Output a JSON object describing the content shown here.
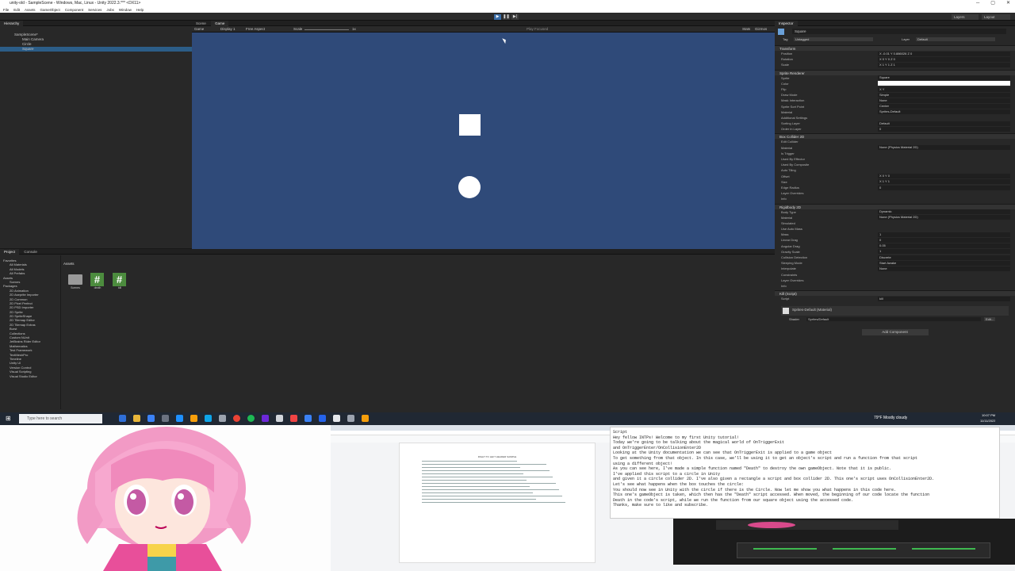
{
  "window": {
    "title": "unity-old - SampleScene - Windows, Mac, Linux - Unity 2022.3.*** <DX11>",
    "menu": [
      "File",
      "Edit",
      "Assets",
      "GameObject",
      "Component",
      "Services",
      "Jobs",
      "Window",
      "Help"
    ],
    "controls": [
      "─",
      "▢",
      "✕"
    ]
  },
  "toolbar": {
    "play": "▶",
    "pause": "❚❚",
    "step": "▶|",
    "layers": "Layers",
    "layout": "Layout"
  },
  "hierarchy": {
    "tab": "Hierarchy",
    "items": [
      "SampleScene*",
      "Main Camera",
      "Circle",
      "Square"
    ]
  },
  "scene": {
    "tabs": [
      "Scene",
      "Game"
    ],
    "toolbar": [
      "Game",
      "Display 1",
      "Free Aspect",
      "Scale",
      "1x",
      "Play Focused",
      "Stats",
      "Gizmos"
    ]
  },
  "project": {
    "tabs": [
      "Project",
      "Console"
    ],
    "tree": [
      "Favorites",
      "All Materials",
      "All Models",
      "All Prefabs",
      "Assets",
      "Scenes",
      "Packages",
      "2D Animation",
      "2D Aseprite Importer",
      "2D Common",
      "2D Pixel Perfect",
      "2D PSD Importer",
      "2D Sprite",
      "2D SpriteShape",
      "2D Tilemap Editor",
      "2D Tilemap Extras",
      "Burst",
      "Collections",
      "Custom NUnit",
      "JetBrains Rider Editor",
      "Mathematics",
      "Test Framework",
      "TextMeshPro",
      "Timeline",
      "Unity UI",
      "Version Control",
      "Visual Scripting",
      "Visual Studio Editor"
    ],
    "breadcrumb": "Assets",
    "assets": [
      {
        "name": "Scenes",
        "kind": "folder"
      },
      {
        "name": "death",
        "kind": "script"
      },
      {
        "name": "kill",
        "kind": "script"
      }
    ]
  },
  "inspector": {
    "tab": "Inspector",
    "object_name": "Square",
    "tag": "Untagged",
    "layer": "Default",
    "components": [
      {
        "title": "Transform",
        "props": [
          [
            "Position",
            "X -0.01   Y 0.886026   Z 0"
          ],
          [
            "Rotation",
            "X 0   Y 0   Z 0"
          ],
          [
            "Scale",
            "X 1   Y 1   Z 1"
          ]
        ]
      },
      {
        "title": "Sprite Renderer",
        "props": [
          [
            "Sprite",
            "Square"
          ],
          [
            "Color",
            ""
          ],
          [
            "Flip",
            "X  Y"
          ],
          [
            "Draw Mode",
            "Simple"
          ],
          [
            "Mask Interaction",
            "None"
          ],
          [
            "Sprite Sort Point",
            "Center"
          ],
          [
            "Material",
            "Sprites-Default"
          ],
          [
            "Additional Settings",
            ""
          ],
          [
            "Sorting Layer",
            "Default"
          ],
          [
            "Order in Layer",
            "0"
          ]
        ]
      },
      {
        "title": "Box Collider 2D",
        "props": [
          [
            "Edit Collider",
            ""
          ],
          [
            "Material",
            "None (Physics Material 2D)"
          ],
          [
            "Is Trigger",
            ""
          ],
          [
            "Used By Effector",
            ""
          ],
          [
            "Used By Composite",
            ""
          ],
          [
            "Auto Tiling",
            ""
          ],
          [
            "Offset",
            "X 0   Y 0"
          ],
          [
            "Size",
            "X 1   Y 1"
          ],
          [
            "Edge Radius",
            "0"
          ],
          [
            "Layer Overrides",
            ""
          ],
          [
            "Info",
            ""
          ]
        ]
      },
      {
        "title": "Rigidbody 2D",
        "props": [
          [
            "Body Type",
            "Dynamic"
          ],
          [
            "Material",
            "None (Physics Material 2D)"
          ],
          [
            "Simulated",
            ""
          ],
          [
            "Use Auto Mass",
            ""
          ],
          [
            "Mass",
            "1"
          ],
          [
            "Linear Drag",
            "0"
          ],
          [
            "Angular Drag",
            "0.05"
          ],
          [
            "Gravity Scale",
            "1"
          ],
          [
            "Collision Detection",
            "Discrete"
          ],
          [
            "Sleeping Mode",
            "Start Awake"
          ],
          [
            "Interpolate",
            "None"
          ],
          [
            "Constraints",
            ""
          ],
          [
            "Layer Overrides",
            ""
          ],
          [
            "Info",
            ""
          ]
        ]
      },
      {
        "title": "Kill (Script)",
        "props": [
          [
            "Script",
            "kill"
          ]
        ]
      }
    ],
    "material": {
      "name": "Sprites-Default (Material)",
      "shader_label": "Shader",
      "shader": "Sprites/Default",
      "edit": "Edit..."
    },
    "add_component": "Add Component"
  },
  "taskbar": {
    "search_placeholder": "Type here to search",
    "weather": "79°F  Mostly cloudy",
    "time": "10:07 PM",
    "date": "11/11/2023"
  },
  "notes": {
    "lines": [
      "Script",
      "Hey fellow INTPs! Welcome to my first Unity tutorial!",
      "Today we're going to be talking about the magical world of OnTriggerExit",
      "and OnTriggerEnter/OnCollisionEnter2D",
      "Looking at the Unity documentation we can see that OnTriggerExit is applied to a game object",
      "To get something from that object. In this case, we'll be using it to get an object's script and run a function from that script",
      "using a different object!",
      "As you can see here, I've made a simple function named \"Death\" to destroy the own gameObject. Note that it is public.",
      "I've applied this script to a circle in Unity",
      "and given it a circle collider 2D. I've also given a rectangle a script and box collider 2D. This one's script uses OnCollisionEnter2D.",
      "Let's see what happens when the box touches the circle:",
      "You should now see in Unity with the circle if there is the Circle. Now let me show you what happens in this code here.",
      "This one's gameObject is taken, which then has the \"Death\" script accessed. When moved, the beginning of our code locate the function",
      "Death in the code's script, while we run the function from our square object using the accessed code.",
      "Thanks, make sure to like and subscribe."
    ]
  },
  "doc": {
    "heading": "RIGHT TO LEFT HEADER SAMPLE"
  }
}
